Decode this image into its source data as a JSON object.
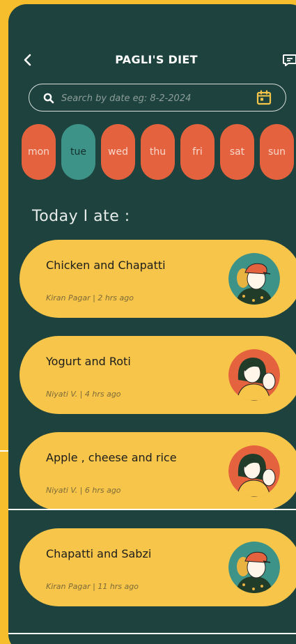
{
  "header": {
    "title": "PAGLI'S DIET"
  },
  "search": {
    "placeholder": "Search by date eg: 8-2-2024",
    "value": ""
  },
  "days": [
    {
      "label": "mon",
      "active": false
    },
    {
      "label": "tue",
      "active": true
    },
    {
      "label": "wed",
      "active": false
    },
    {
      "label": "thu",
      "active": false
    },
    {
      "label": "fri",
      "active": false
    },
    {
      "label": "sat",
      "active": false
    },
    {
      "label": "sun",
      "active": false
    }
  ],
  "section": {
    "title": "Today I ate :"
  },
  "entries": [
    {
      "title": "Chicken and Chapatti",
      "meta": "Kiran Pagar  |  2 hrs ago",
      "avatar": "boy-avatar"
    },
    {
      "title": "Yogurt and Roti",
      "meta": "Niyati V. |  4 hrs ago",
      "avatar": "girl-avatar"
    },
    {
      "title": "Apple , cheese and rice",
      "meta": "Niyati V.  |  6 hrs ago",
      "avatar": "girl-avatar"
    },
    {
      "title": "Chapatti and Sabzi",
      "meta": "Kiran Pagar  |  11 hrs ago",
      "avatar": "boy-avatar"
    }
  ],
  "colors": {
    "background": "#1e433e",
    "frame": "#f6be2c",
    "day_inactive": "#e4623e",
    "day_active": "#3e9388",
    "card": "#f6c549"
  }
}
